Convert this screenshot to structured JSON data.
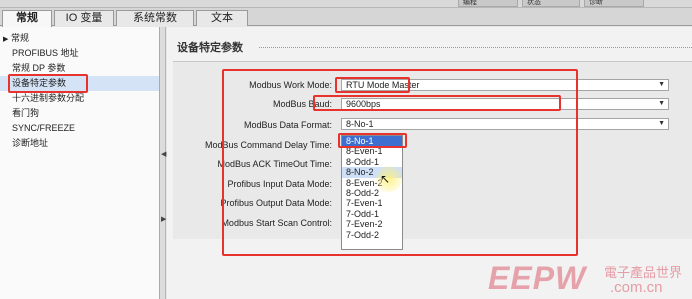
{
  "top_strip": {
    "tabs": [
      "编程",
      "状态",
      "诊断"
    ]
  },
  "tabs": [
    {
      "label": "常规"
    },
    {
      "label": "IO 变量"
    },
    {
      "label": "系统常数"
    },
    {
      "label": "文本"
    }
  ],
  "tree": {
    "root": "常规",
    "items": [
      "PROFIBUS 地址",
      "常规 DP 参数",
      "设备特定参数",
      "十六进制参数分配",
      "看门狗",
      "SYNC/FREEZE",
      "诊断地址"
    ]
  },
  "section": {
    "title": "设备特定参数"
  },
  "params": [
    {
      "label": "Modbus Work Mode:",
      "value": "RTU Mode Master"
    },
    {
      "label": "ModBus Baud:",
      "value": "9600bps"
    },
    {
      "label": "ModBus Data Format:",
      "value": "8-No-1"
    },
    {
      "label": "ModBus Command Delay Time:",
      "value": ""
    },
    {
      "label": "ModBus ACK TimeOut Time:",
      "value": ""
    },
    {
      "label": "Profibus Input Data Mode:",
      "value": ""
    },
    {
      "label": "Profibus Output Data Mode:",
      "value": ""
    },
    {
      "label": "Modbus Start Scan Control:",
      "value": ""
    }
  ],
  "dropdown": {
    "options": [
      "8-No-1",
      "8-Even-1",
      "8-Odd-1",
      "8-No-2",
      "8-Even-2",
      "8-Odd-2",
      "7-Even-1",
      "7-Odd-1",
      "7-Even-2",
      "7-Odd-2"
    ],
    "selected": "8-No-1",
    "hovered": "8-No-2"
  },
  "watermark": {
    "logo": "EEPW",
    "text_cn": "電子產品世界",
    "url": ".com.cn"
  },
  "colors": {
    "annotation_red": "#e8322e",
    "selection_blue": "#3d6fd0",
    "tree_highlight": "#d4e4f6"
  }
}
